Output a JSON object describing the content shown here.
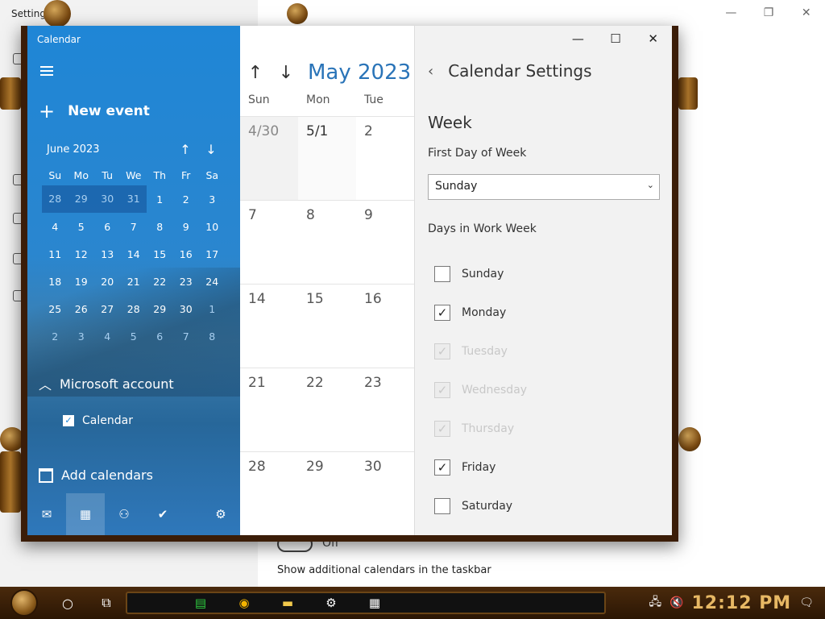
{
  "background_window": {
    "title": "Settings",
    "controls": [
      "—",
      "❐",
      "✕"
    ],
    "toggle_label": "Off",
    "text": "Show additional calendars in the taskbar"
  },
  "calendar_app": {
    "title": "Calendar",
    "new_event": "New event",
    "mini_calendar": {
      "month": "June 2023",
      "weekdays": [
        "Su",
        "Mo",
        "Tu",
        "We",
        "Th",
        "Fr",
        "Sa"
      ],
      "weeks": [
        [
          "28",
          "29",
          "30",
          "31",
          "1",
          "2",
          "3"
        ],
        [
          "4",
          "5",
          "6",
          "7",
          "8",
          "9",
          "10"
        ],
        [
          "11",
          "12",
          "13",
          "14",
          "15",
          "16",
          "17"
        ],
        [
          "18",
          "19",
          "20",
          "21",
          "22",
          "23",
          "24"
        ],
        [
          "25",
          "26",
          "27",
          "28",
          "29",
          "30",
          "1"
        ],
        [
          "2",
          "3",
          "4",
          "5",
          "6",
          "7",
          "8"
        ]
      ]
    },
    "account": "Microsoft account",
    "calendar_item": "Calendar",
    "add_calendars": "Add calendars",
    "month_view": {
      "title": "May 2023",
      "weekdays": [
        "Sun",
        "Mon",
        "Tue"
      ],
      "weeks": [
        [
          "4/30",
          "5/1",
          "2"
        ],
        [
          "7",
          "8",
          "9"
        ],
        [
          "14",
          "15",
          "16"
        ],
        [
          "21",
          "22",
          "23"
        ],
        [
          "28",
          "29",
          "30"
        ]
      ]
    },
    "settings": {
      "title": "Calendar Settings",
      "section": "Week",
      "first_day_label": "First Day of Week",
      "first_day_value": "Sunday",
      "work_week_label": "Days in Work Week",
      "days": [
        {
          "label": "Sunday",
          "checked": false,
          "disabled": false
        },
        {
          "label": "Monday",
          "checked": true,
          "disabled": false
        },
        {
          "label": "Tuesday",
          "checked": true,
          "disabled": true
        },
        {
          "label": "Wednesday",
          "checked": true,
          "disabled": true
        },
        {
          "label": "Thursday",
          "checked": true,
          "disabled": true
        },
        {
          "label": "Friday",
          "checked": true,
          "disabled": false
        },
        {
          "label": "Saturday",
          "checked": false,
          "disabled": false
        }
      ]
    }
  },
  "taskbar": {
    "time": "12:12 PM"
  }
}
